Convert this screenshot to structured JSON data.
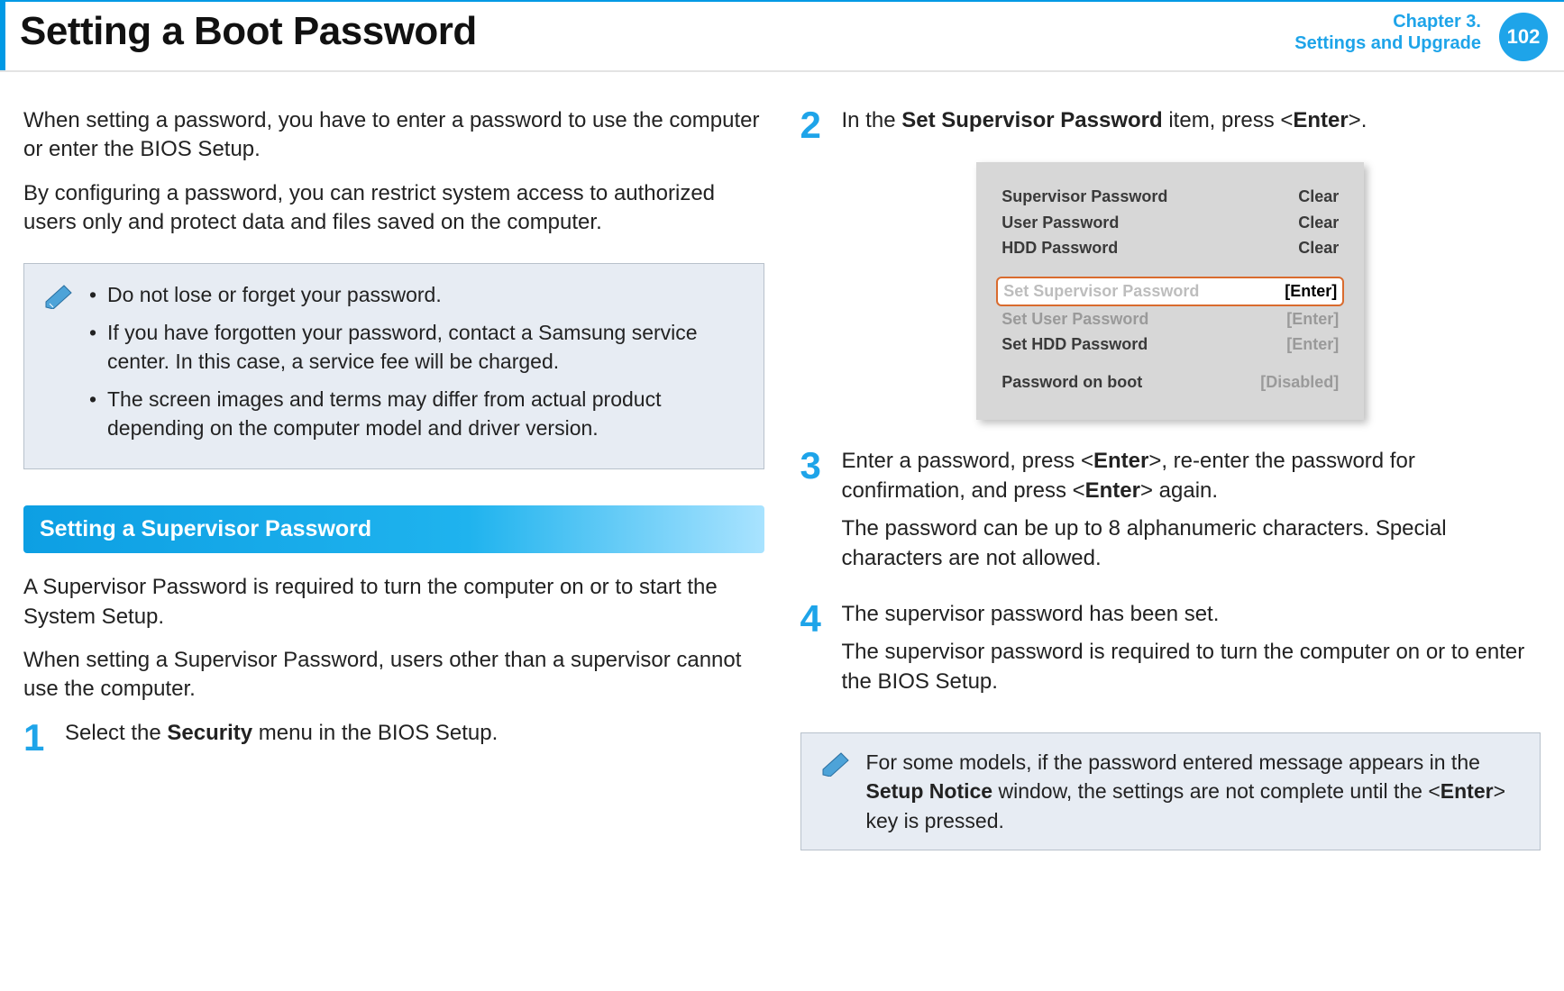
{
  "header": {
    "title": "Setting a Boot Password",
    "chapter_line1": "Chapter 3.",
    "chapter_line2": "Settings and Upgrade",
    "page_number": "102"
  },
  "left": {
    "intro1": "When setting a password, you have to enter a password to use the computer or enter the BIOS Setup.",
    "intro2": "By configuring a password, you can restrict system access to authorized users only and protect data and files saved on the computer.",
    "note_items": [
      "Do not lose or forget your password.",
      "If you have forgotten your password, contact a Samsung service center. In this case, a service fee will be charged.",
      "The screen images and terms may differ from actual product depending on the computer model and driver version."
    ],
    "section_title": "Setting a Supervisor Password",
    "sup_p1": "A Supervisor Password is required to turn the computer on or to start the System Setup.",
    "sup_p2": "When setting a Supervisor Password, users other than a supervisor cannot use the computer.",
    "step1_num": "1",
    "step1_pre": "Select the ",
    "step1_bold": "Security",
    "step1_post": " menu in the BIOS Setup."
  },
  "right": {
    "step2_num": "2",
    "step2_pre": "In the ",
    "step2_bold1": "Set Supervisor Password",
    "step2_mid": " item, press <",
    "step2_bold2": "Enter",
    "step2_post": ">.",
    "step3_num": "3",
    "step3_a_pre": "Enter a password, press <",
    "step3_a_b1": "Enter",
    "step3_a_mid": ">, re-enter the password for confirmation, and press <",
    "step3_a_b2": "Enter",
    "step3_a_post": "> again.",
    "step3_b": "The password can be up to 8 alphanumeric characters. Special characters are not allowed.",
    "step4_num": "4",
    "step4_a": "The supervisor password has been set.",
    "step4_b": "The supervisor password is required to turn the computer on or to enter the BIOS Setup.",
    "note2_pre": "For some models, if the password entered message appears in the ",
    "note2_bold1": "Setup Notice",
    "note2_mid": " window, the settings are not complete until the <",
    "note2_bold2": "Enter",
    "note2_post": "> key is pressed."
  },
  "bios": {
    "rows_top": [
      {
        "label": "Supervisor Password",
        "value": "Clear"
      },
      {
        "label": "User Password",
        "value": "Clear"
      },
      {
        "label": "HDD Password",
        "value": "Clear"
      }
    ],
    "highlight": {
      "label": "Set Supervisor Password",
      "value": "[Enter]"
    },
    "rows_mid": [
      {
        "label": "Set User Password",
        "value": "[Enter]"
      },
      {
        "label": "Set HDD Password",
        "value": "[Enter]"
      }
    ],
    "row_bottom": {
      "label": "Password on boot",
      "value": "[Disabled]"
    }
  }
}
